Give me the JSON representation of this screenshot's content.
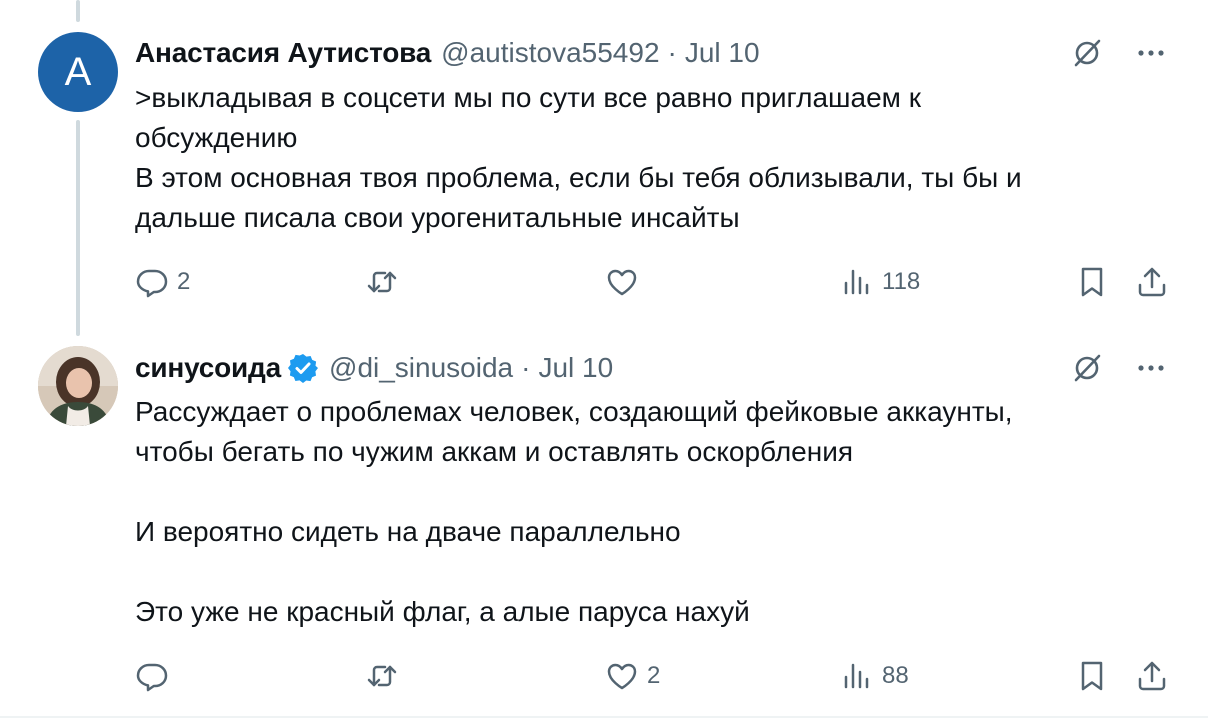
{
  "tweets": [
    {
      "avatar_letter": "A",
      "author_name": "Анастасия Аутистова",
      "handle": "@autistova55492",
      "separator": "·",
      "date": "Jul 10",
      "verified": false,
      "lines": [
        ">выкладывая в соцсети мы по сути все равно приглашаем к",
        "обсуждению",
        "В этом основная твоя проблема, если бы тебя облизывали, ты бы и",
        "дальше писала свои урогенитальные инсайты"
      ],
      "replies": "2",
      "retweets": "",
      "likes": "",
      "views": "118",
      "avatar_color": "#1d63a8"
    },
    {
      "avatar_letter": "",
      "author_name": "синусоида",
      "handle": "@di_sinusoida",
      "separator": "·",
      "date": "Jul 10",
      "verified": true,
      "lines": [
        "Рассуждает о проблемах человек, создающий фейковые аккаунты,",
        "чтобы бегать по чужим аккам и оставлять оскорбления",
        "",
        "И вероятно сидеть на дваче параллельно",
        "",
        "Это уже не красный флаг, а алые паруса нахуй"
      ],
      "replies": "",
      "retweets": "",
      "likes": "2",
      "views": "88"
    }
  ],
  "icons": {
    "reply": "speech-bubble-icon",
    "retweet": "retweet-arrows-icon",
    "like": "heart-icon",
    "views": "bar-chart-icon",
    "bookmark": "bookmark-icon",
    "share": "share-upload-icon",
    "grok": "grok-slash-icon",
    "more": "more-dots-icon",
    "verified": "verified-badge-icon"
  },
  "colors": {
    "text": "#0f1419",
    "secondary": "#536471",
    "verified": "#1d9bf0",
    "thread_line": "#cfd9de"
  }
}
